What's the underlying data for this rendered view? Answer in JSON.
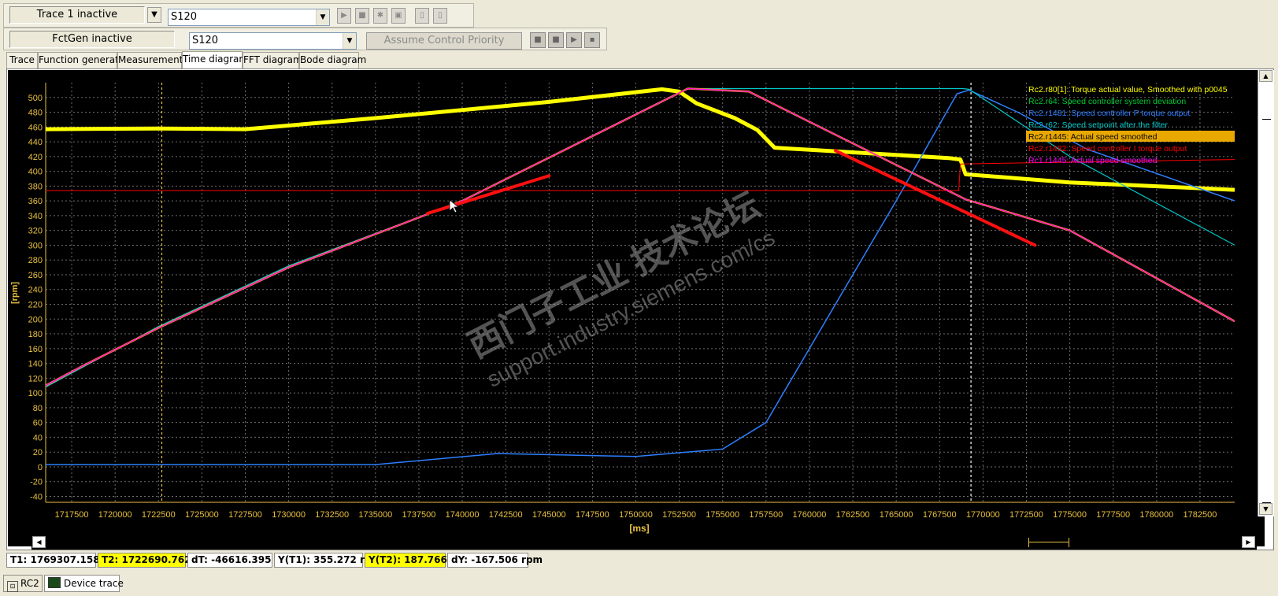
{
  "trace_bar": {
    "status": "Trace 1 inactive",
    "device": "S120"
  },
  "fctgen_bar": {
    "status": "FctGen  inactive",
    "device": "S120",
    "assume_label": "Assume Control Priority"
  },
  "tabs": [
    {
      "label": "Trace"
    },
    {
      "label": "Function generator"
    },
    {
      "label": "Measurements"
    },
    {
      "label": "Time diagram"
    },
    {
      "label": "FFT diagram"
    },
    {
      "label": "Bode diagram"
    }
  ],
  "chart_data": {
    "type": "line",
    "xlabel": "[ms]",
    "ylabel": "[rpm]",
    "xlim": [
      1716000,
      1784500
    ],
    "ylim": [
      -48,
      520
    ],
    "grid": true,
    "legend_position": "top-right",
    "y_ticks": [
      "500",
      "480",
      "460",
      "440",
      "420",
      "400",
      "380",
      "360",
      "340",
      "320",
      "300",
      "280",
      "260",
      "240",
      "220",
      "200",
      "180",
      "160",
      "140",
      "120",
      "100",
      "80",
      "60",
      "40",
      "20",
      "0",
      "-20",
      "-40"
    ],
    "x_ticks": [
      "1717500",
      "1720000",
      "1722500",
      "1725000",
      "1727500",
      "1730000",
      "1732500",
      "1735000",
      "1737500",
      "1740000",
      "1742500",
      "1745000",
      "1747500",
      "1750000",
      "1752500",
      "1755000",
      "1757500",
      "1760000",
      "1762500",
      "1765000",
      "1767500",
      "1770000",
      "1772500",
      "1775000",
      "1777500",
      "1780000",
      "1782500"
    ],
    "series": [
      {
        "name": "Rc2.r80[1]: Torque actual value, Smoothed with p0045",
        "color": "#ffff00",
        "x": [
          1716000,
          1722500,
          1727500,
          1735000,
          1745000,
          1751500,
          1752500,
          1753500,
          1755700,
          1757000,
          1758000,
          1768000,
          1768700,
          1769000,
          1775000,
          1784500
        ],
        "y": [
          457,
          458,
          457,
          472,
          494,
          511,
          508,
          492,
          472,
          456,
          432,
          418,
          416,
          396,
          385,
          375
        ]
      },
      {
        "name": "Rc2.r64: Speed controller system deviation",
        "color": "#00cc33",
        "x": [],
        "y": []
      },
      {
        "name": "Rc2.r1481: Speed controller P torque output",
        "color": "#2f7fff",
        "x": [
          1716000,
          1735000,
          1742000,
          1750000,
          1755000,
          1757500,
          1760000,
          1765000,
          1768500,
          1769200,
          1772000,
          1776000,
          1784500
        ],
        "y": [
          3,
          3,
          18,
          14,
          24,
          60,
          160,
          360,
          505,
          510,
          480,
          430,
          360
        ]
      },
      {
        "name": "Rc2.r62: Speed setpoint after the filter",
        "color": "#00c8c8",
        "x": [
          1716000,
          1722500,
          1730000,
          1740000,
          1753000,
          1768800,
          1769200,
          1775000,
          1784500
        ],
        "y": [
          108,
          190,
          272,
          360,
          512,
          512,
          511,
          420,
          300
        ]
      },
      {
        "name": "Rc2.r1445: Actual speed smoothed",
        "color": "#ff9900",
        "x": [
          1716000,
          1718000,
          1722500,
          1730000,
          1740000,
          1753000,
          1756500,
          1769000,
          1775000,
          1784500
        ],
        "y": [
          110,
          135,
          188,
          270,
          360,
          512,
          508,
          362,
          320,
          197
        ]
      },
      {
        "name": "Rc2.r1482: Speed controller I torque output",
        "color": "#ff0000",
        "x": [
          1716000,
          1768600,
          1768700,
          1784500
        ],
        "y": [
          374,
          374,
          410,
          416
        ]
      },
      {
        "name": "Rc1.r1445: Actual speed smoothed",
        "color": "#ff00ff",
        "x": [
          1716000,
          1718000,
          1722500,
          1730000,
          1740000,
          1753000,
          1756500,
          1769000,
          1775000,
          1784500
        ],
        "y": [
          110,
          135,
          188,
          270,
          360,
          512,
          508,
          362,
          320,
          197
        ]
      }
    ],
    "selected_legend": "Rc2.r1445: Actual speed smoothed",
    "cursors": {
      "t1": 1769307.158,
      "t2": 1722690.762
    },
    "annotation_arrows": [
      {
        "x": [
          1738000,
          1745000
        ],
        "y": [
          343,
          394
        ]
      },
      {
        "x": [
          1761500,
          1773000
        ],
        "y": [
          428,
          300
        ]
      }
    ],
    "watermark_line1": "西门子工业 技术论坛",
    "watermark_line2": "support.industry.siemens.com/cs"
  },
  "cursor_values": {
    "t1": "T1: 1769307.158 ms",
    "t2": "T2: 1722690.762 ms",
    "dt": "dT: -46616.395 ms",
    "yt1": "Y(T1):  355.272 rpm",
    "yt2": "Y(T2): 187.766 rpm",
    "dy": "dY: -167.506 rpm"
  },
  "bottom_tabs": [
    {
      "label": "RC2"
    },
    {
      "label": "Device trace"
    }
  ],
  "colors": {
    "plot_background": "#000000",
    "grid": "#808080",
    "axis_text": "#e8c040",
    "legend_highlight": "#e8a800"
  }
}
